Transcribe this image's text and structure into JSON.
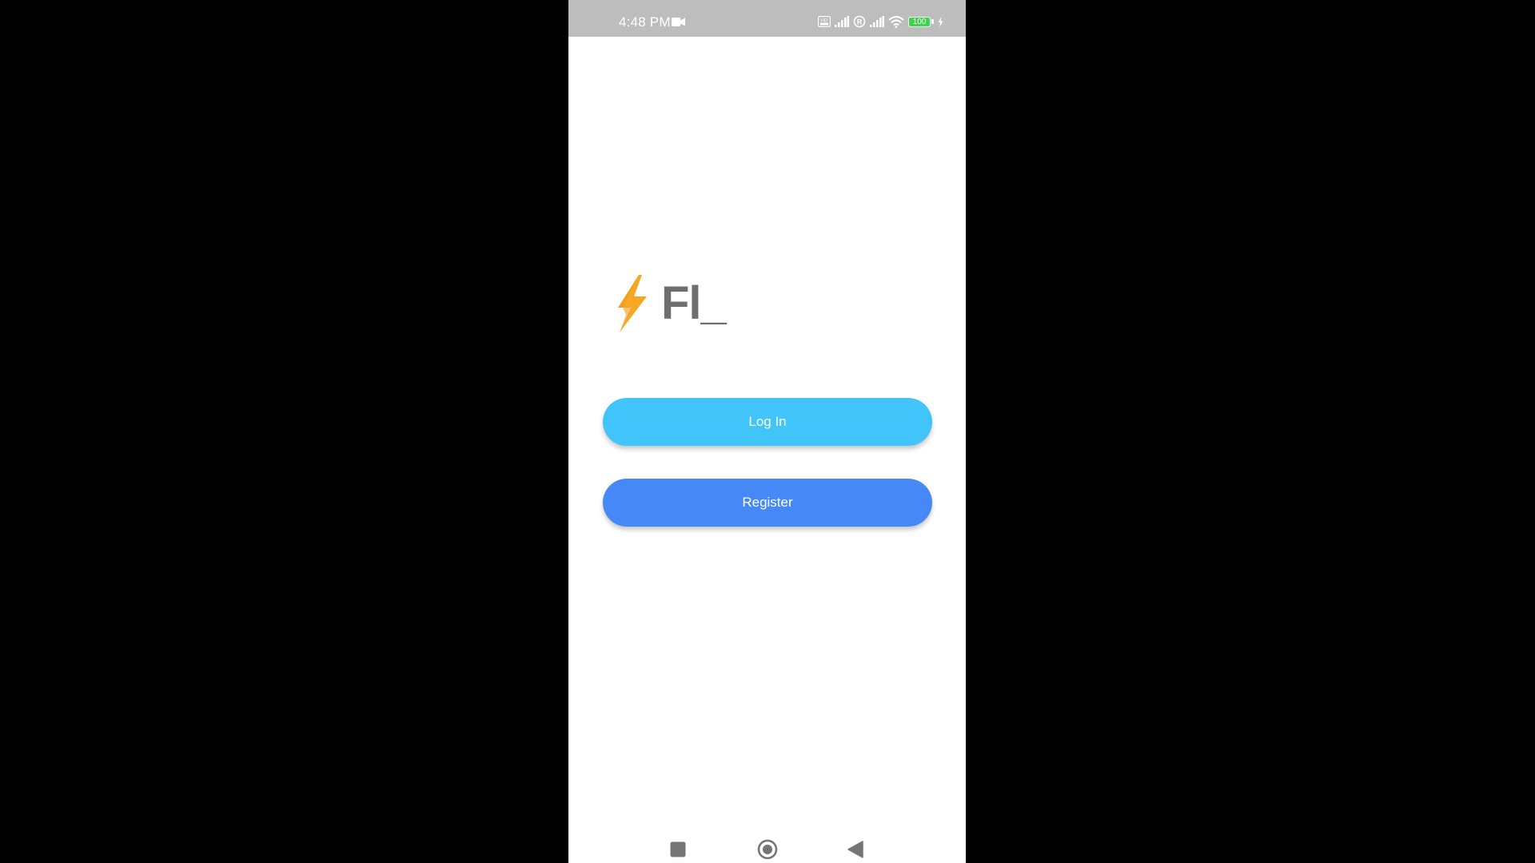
{
  "status_bar": {
    "time": "4:48 PM",
    "battery_level": "100",
    "icons": [
      "video-record-icon",
      "hd-icon",
      "signal-icon",
      "registered-icon",
      "signal-icon",
      "wifi-icon",
      "battery-icon",
      "charging-icon"
    ]
  },
  "app": {
    "logo_icon": "lightning-bolt-icon",
    "logo_text": "Fl_"
  },
  "buttons": {
    "login_label": "Log In",
    "register_label": "Register"
  },
  "nav_bar": {
    "icons": [
      "recent-apps-icon",
      "home-icon",
      "back-icon"
    ]
  },
  "colors": {
    "status_bar": "#bdbdbd",
    "login_button": "#40c4fa",
    "register_button": "#4689f6",
    "logo_bolt": "#f7a823",
    "logo_text": "#6e6e6e"
  }
}
